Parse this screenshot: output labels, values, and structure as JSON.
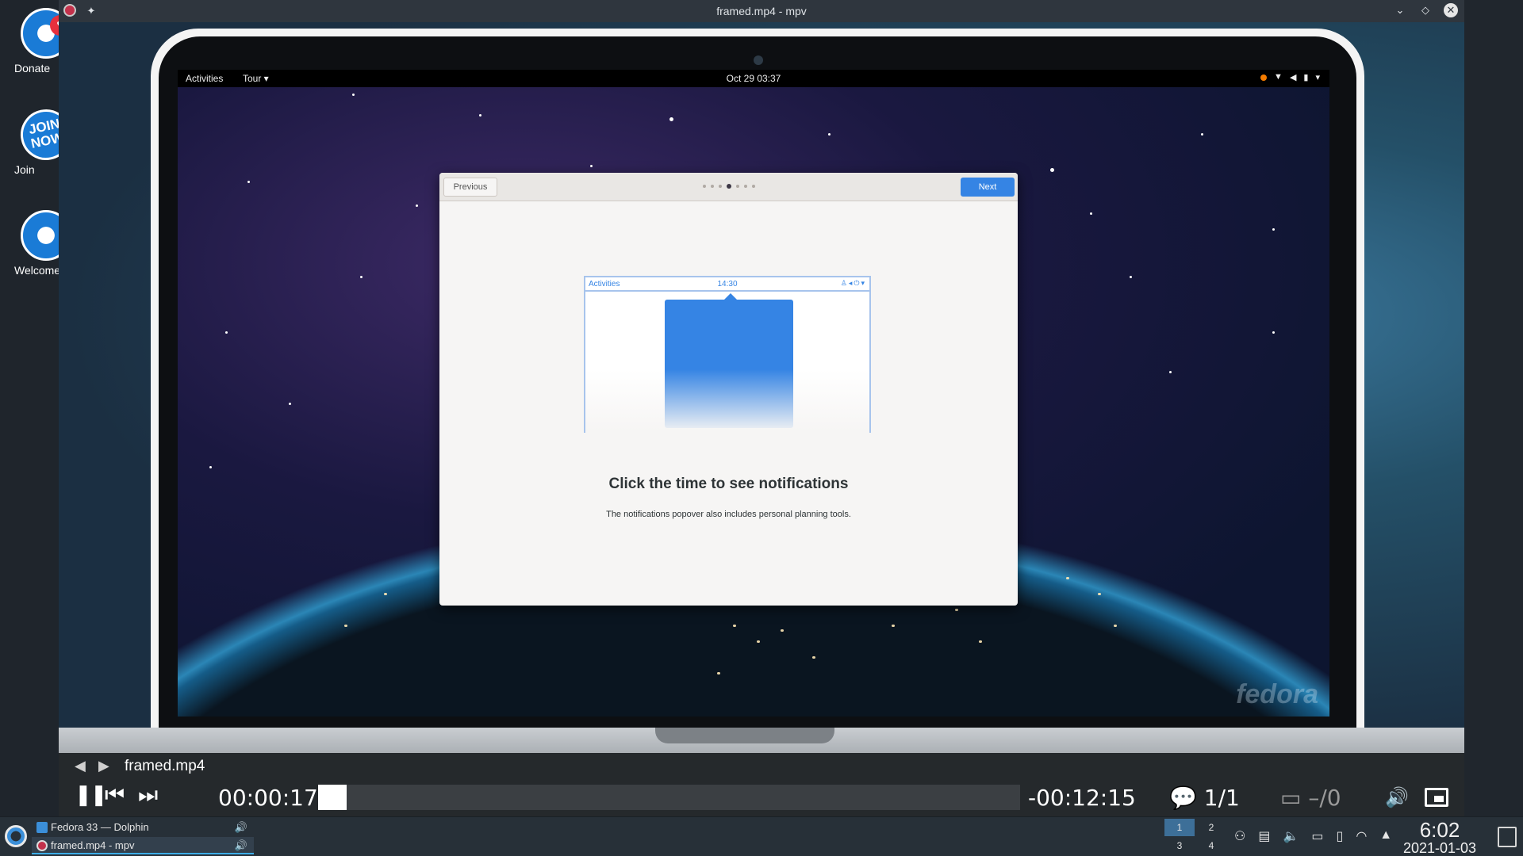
{
  "desktop": {
    "icons": [
      {
        "label": "Donate"
      },
      {
        "label": "Join",
        "badge": "JOIN NOW"
      },
      {
        "label": "Welcome"
      }
    ]
  },
  "window": {
    "title": "framed.mp4 - mpv"
  },
  "gnome_topbar": {
    "activities": "Activities",
    "tour": "Tour ▾",
    "clock": "Oct 29  03:37"
  },
  "tour_dialog": {
    "previous_label": "Previous",
    "next_label": "Next",
    "page_count": 7,
    "active_page": 3,
    "illustration": {
      "activities": "Activities",
      "time": "14:30"
    },
    "title": "Click the time to see notifications",
    "subtitle": "The notifications popover also includes personal planning tools."
  },
  "watermark": "fedora",
  "osc": {
    "filename": "framed.mp4",
    "time_position": "00:00:17",
    "time_remaining": "-00:12:15",
    "progress": 0.02,
    "subtitle_count": "1/1",
    "subtitle_track": "–/0"
  },
  "taskbar": {
    "tasks": [
      {
        "label": "Fedora 33 — Dolphin",
        "active": false
      },
      {
        "label": "framed.mp4 - mpv",
        "active": true
      }
    ],
    "pager": [
      "1",
      "2",
      "3",
      "4"
    ],
    "active_desktop": "1",
    "clock_time": "6:02",
    "clock_date": "2021-01-03"
  },
  "colors": {
    "accent": "#3584e4",
    "kde_highlight": "#3daee9"
  }
}
